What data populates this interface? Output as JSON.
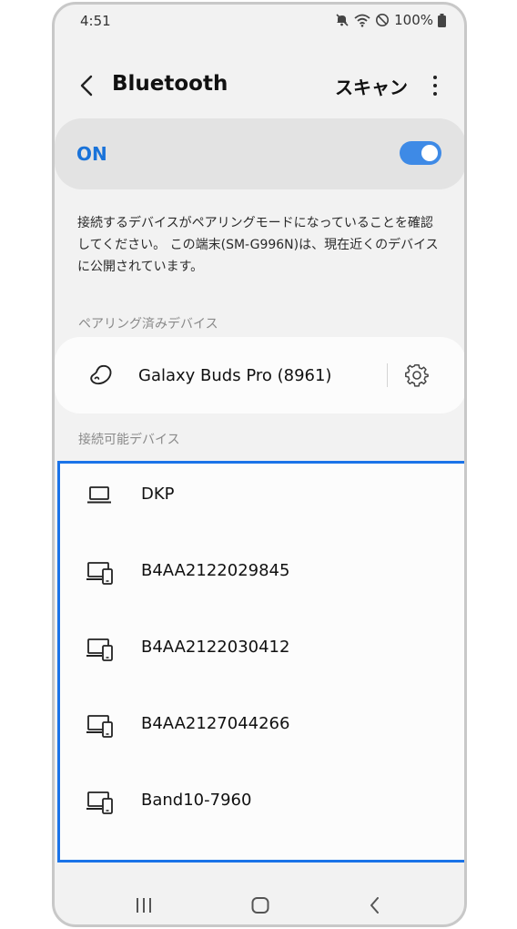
{
  "status_bar": {
    "time": "4:51",
    "battery": "100%"
  },
  "app_bar": {
    "title": "Bluetooth",
    "scan_label": "スキャン"
  },
  "bluetooth_switch": {
    "label": "ON",
    "enabled": true,
    "accent_color": "#3e8ae6"
  },
  "info": {
    "text": "接続するデバイスがペアリングモードになっていることを確認してください。 この端末(SM-G996N)は、現在近くのデバイスに公開されています。"
  },
  "paired_section": {
    "label": "ペアリング済みデバイス",
    "devices": [
      {
        "name": "Galaxy Buds Pro (8961)",
        "icon": "earbud-icon"
      }
    ]
  },
  "available_section": {
    "label": "接続可能デバイス",
    "highlight_color": "#1a73e8",
    "devices": [
      {
        "name": "DKP",
        "icon": "laptop-icon"
      },
      {
        "name": "B4AA2122029845",
        "icon": "devices-icon"
      },
      {
        "name": "B4AA2122030412",
        "icon": "devices-icon"
      },
      {
        "name": "B4AA2127044266",
        "icon": "devices-icon"
      },
      {
        "name": "Band10-7960",
        "icon": "devices-icon"
      }
    ]
  },
  "nav_bar": {
    "icons": [
      "recents-icon",
      "home-icon",
      "back-icon"
    ]
  }
}
